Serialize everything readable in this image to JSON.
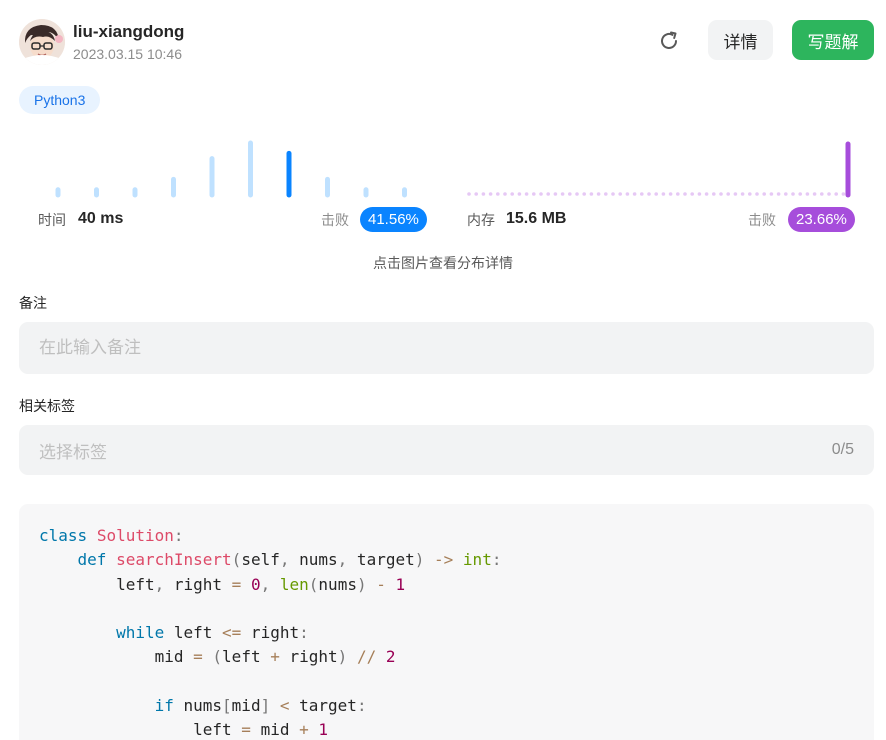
{
  "header": {
    "user_name": "liu-xiangdong",
    "timestamp": "2023.03.15 10:46",
    "refresh_icon": "refresh-icon",
    "detail_label": "详情",
    "write_label": "写题解"
  },
  "language_tag": "Python3",
  "runtime": {
    "label": "时间",
    "value": "40 ms",
    "beat_label": "击败",
    "beat_value": "41.56%",
    "color": "#0a84ff",
    "bar_color": "#bfe1ff",
    "distribution": [
      1,
      1,
      1,
      3,
      7,
      10,
      8,
      3,
      1,
      1
    ],
    "selected_index": 6
  },
  "memory": {
    "label": "内存",
    "value": "15.6 MB",
    "beat_label": "击败",
    "beat_value": "23.66%",
    "color": "#a64ddb",
    "dot_color": "#e6c8f5"
  },
  "chart_hint": "点击图片查看分布详情",
  "note": {
    "label": "备注",
    "placeholder": "在此输入备注"
  },
  "tags": {
    "label": "相关标签",
    "placeholder": "选择标签",
    "count": "0/5"
  },
  "code": {
    "language": "python",
    "lines": [
      "class Solution:",
      "    def searchInsert(self, nums, target) -> int:",
      "        left, right = 0, len(nums) - 1",
      "",
      "        while left <= right:",
      "            mid = (left + right) // 2",
      "",
      "            if nums[mid] < target:",
      "                left = mid + 1"
    ]
  }
}
